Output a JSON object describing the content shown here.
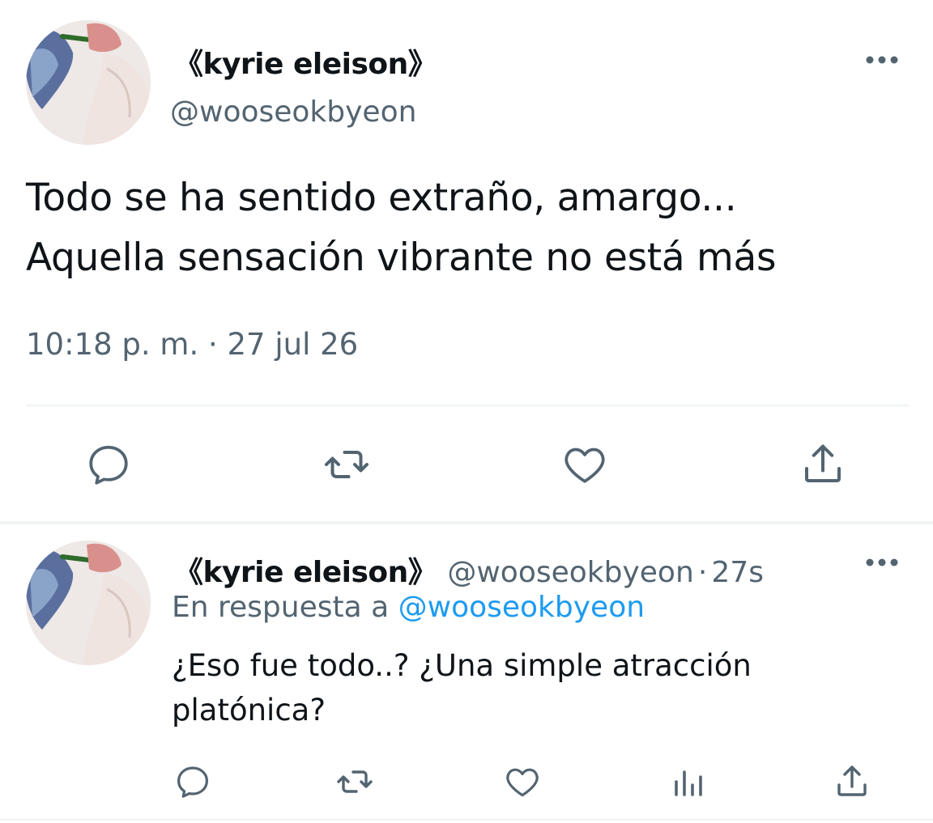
{
  "main_tweet": {
    "display_name": "《kyrie eleison》",
    "handle": "@wooseokbyeon",
    "text": "Todo se ha sentido extraño, amargo... Aquella sensación vibrante no está más",
    "time": "10:18 p. m.",
    "separator": "·",
    "date": "27 jul 26",
    "more_label": "•••"
  },
  "reply_tweet": {
    "display_name": "《kyrie eleison》",
    "handle": "@wooseokbyeon",
    "separator": "·",
    "age": "27s",
    "reply_prefix": "En respuesta a",
    "reply_to": "@wooseokbyeon",
    "text": "¿Eso fue todo..? ¿Una simple atracción platónica?",
    "more_label": "•••"
  },
  "icons": {
    "reply": "speech-bubble-icon",
    "retweet": "retweet-icon",
    "like": "heart-icon",
    "share": "share-icon",
    "analytics": "analytics-icon",
    "more": "more-icon"
  },
  "colors": {
    "text": "#0f1419",
    "secondary": "#536471",
    "link": "#1d9bf0",
    "divider": "#eff3f4"
  }
}
